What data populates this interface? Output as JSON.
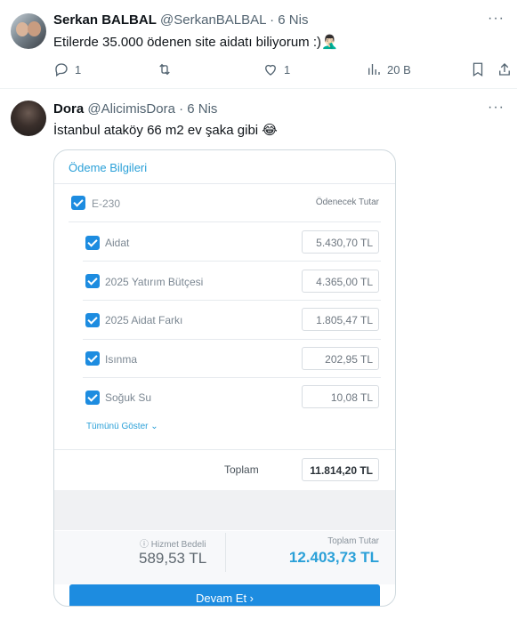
{
  "tweet1": {
    "name": "Serkan BALBAL",
    "handle_meta": "@SerkanBALBAL · 6 Nis",
    "more": "···",
    "text": "Etilerde 35.000 ödenen site aidatı biliyorum :)🤦🏻‍♂️",
    "actions": {
      "replies": "1",
      "retweets": "",
      "likes": "1",
      "views": "20 B"
    }
  },
  "tweet2": {
    "name": "Dora",
    "handle_meta": "@AlicimisDora · 6 Nis",
    "more": "···",
    "text": "İstanbul ataköy 66 m2 ev şaka gibi 😂"
  },
  "card": {
    "title": "Ödeme Bilgileri",
    "group_label": "E-230",
    "amount_header": "Ödenecek Tutar",
    "items": [
      {
        "label": "Aidat",
        "value": "5.430,70 TL"
      },
      {
        "label": "2025 Yatırım Bütçesi",
        "value": "4.365,00 TL"
      },
      {
        "label": "2025 Aidat Farkı",
        "value": "1.805,47 TL"
      },
      {
        "label": "Isınma",
        "value": "202,95 TL"
      },
      {
        "label": "Soğuk Su",
        "value": "10,08 TL"
      }
    ],
    "show_all": "Tümünü Göster",
    "total_label": "Toplam",
    "total_value": "11.814,20 TL",
    "service_label": "Hizmet Bedeli",
    "service_value": "589,53 TL",
    "grand_label": "Toplam Tutar",
    "grand_value": "12.403,73 TL",
    "button": "Devam Et ›",
    "colors": {
      "accent": "#1d8ce0",
      "title": "#2aa0d8"
    }
  }
}
